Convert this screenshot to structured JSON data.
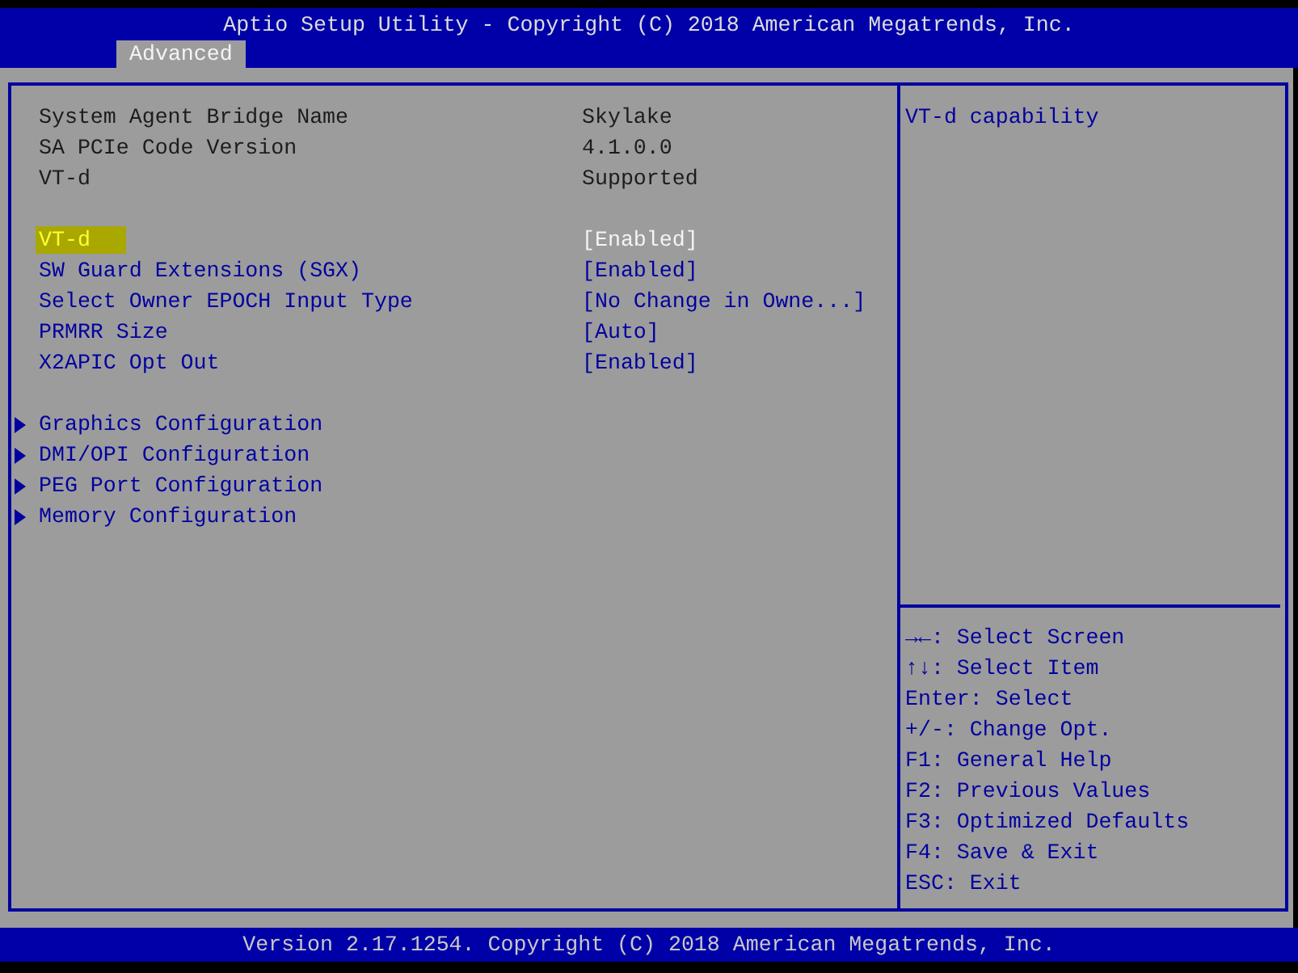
{
  "header": {
    "title": "Aptio Setup Utility - Copyright (C) 2018 American Megatrends, Inc.",
    "tabs": [
      {
        "label": "Advanced",
        "selected": true
      }
    ]
  },
  "settings": {
    "groups": [
      {
        "items": [
          {
            "kind": "info",
            "label": "System Agent Bridge Name",
            "value": "Skylake"
          },
          {
            "kind": "info",
            "label": "SA PCIe Code Version",
            "value": "4.1.0.0"
          },
          {
            "kind": "info",
            "label": "VT-d",
            "value": "Supported"
          }
        ]
      },
      {
        "items": [
          {
            "kind": "option",
            "label": "VT-d",
            "value": "[Enabled]",
            "selected": true
          },
          {
            "kind": "option",
            "label": "SW Guard Extensions (SGX)",
            "value": "[Enabled]",
            "selected": false
          },
          {
            "kind": "option",
            "label": "Select Owner EPOCH Input Type",
            "value": "[No Change in Owne...]",
            "selected": false
          },
          {
            "kind": "option",
            "label": "PRMRR Size",
            "value": "[Auto]",
            "selected": false
          },
          {
            "kind": "option",
            "label": "X2APIC Opt Out",
            "value": "[Enabled]",
            "selected": false
          }
        ]
      },
      {
        "items": [
          {
            "kind": "submenu",
            "label": "Graphics Configuration",
            "selected": false
          },
          {
            "kind": "submenu",
            "label": "DMI/OPI Configuration",
            "selected": false
          },
          {
            "kind": "submenu",
            "label": "PEG Port Configuration",
            "selected": false
          },
          {
            "kind": "submenu",
            "label": "Memory Configuration",
            "selected": false
          }
        ]
      }
    ]
  },
  "help": {
    "description": "VT-d capability",
    "keys": [
      "→←: Select Screen",
      "↑↓: Select Item",
      "Enter: Select",
      "+/-: Change Opt.",
      "F1: General Help",
      "F2: Previous Values",
      "F3: Optimized Defaults",
      "F4: Save & Exit",
      "ESC: Exit"
    ]
  },
  "footer": {
    "text": "Version 2.17.1254. Copyright (C) 2018 American Megatrends, Inc."
  }
}
